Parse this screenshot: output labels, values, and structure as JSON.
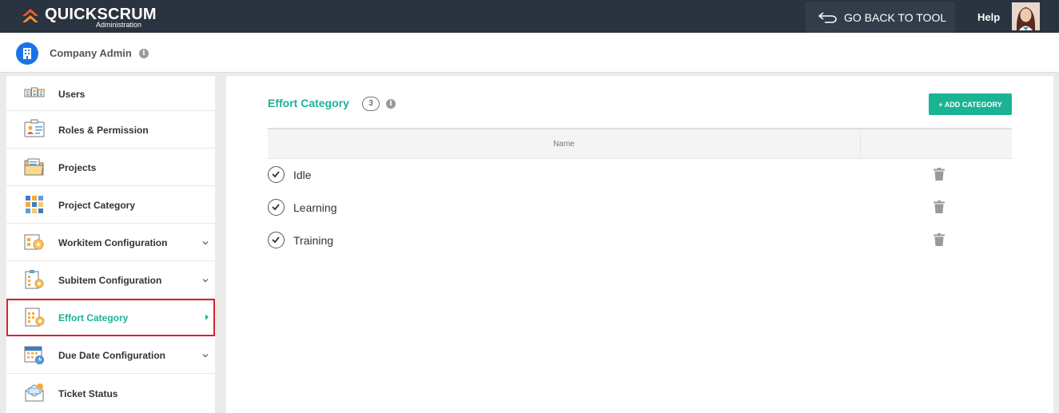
{
  "header": {
    "logo_text": "QUICKSCRUM",
    "logo_subtitle": "Administration",
    "back_button": "GO BACK TO TOOL",
    "help": "Help"
  },
  "company": {
    "label": "Company Admin"
  },
  "sidebar": {
    "items": [
      {
        "label": "Users"
      },
      {
        "label": "Roles & Permission"
      },
      {
        "label": "Projects"
      },
      {
        "label": "Project Category"
      },
      {
        "label": "Workitem Configuration"
      },
      {
        "label": "Subitem Configuration"
      },
      {
        "label": "Effort Category"
      },
      {
        "label": "Due Date Configuration"
      },
      {
        "label": "Ticket Status"
      }
    ]
  },
  "main": {
    "title": "Effort Category",
    "count": "3",
    "add_button": "+ ADD CATEGORY",
    "table": {
      "headers": [
        "Name"
      ],
      "rows": [
        {
          "name": "Idle"
        },
        {
          "name": "Learning"
        },
        {
          "name": "Training"
        }
      ]
    }
  },
  "colors": {
    "accent": "#1ab394",
    "topbar": "#2a3340",
    "highlight_border": "#d9232e",
    "company_icon": "#1a73e8"
  }
}
